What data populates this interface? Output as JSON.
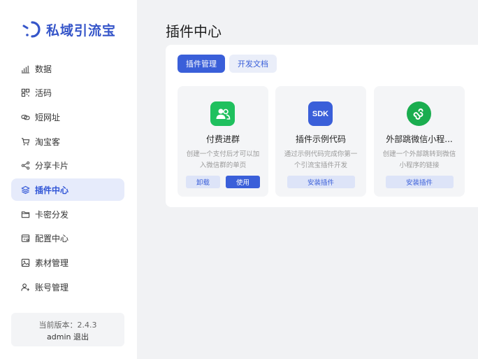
{
  "brand": {
    "name": "私域引流宝",
    "color": "#3555c9"
  },
  "sidebar": {
    "items": [
      {
        "label": "数据",
        "icon": "bar-chart-icon",
        "active": false
      },
      {
        "label": "活码",
        "icon": "qrcode-icon",
        "active": false
      },
      {
        "label": "短网址",
        "icon": "link-icon",
        "active": false
      },
      {
        "label": "淘宝客",
        "icon": "cart-icon",
        "active": false
      },
      {
        "label": "分享卡片",
        "icon": "share-icon",
        "active": false
      },
      {
        "label": "插件中心",
        "icon": "layers-icon",
        "active": true
      },
      {
        "label": "卡密分发",
        "icon": "folder-icon",
        "active": false
      },
      {
        "label": "配置中心",
        "icon": "settings-card-icon",
        "active": false
      },
      {
        "label": "素材管理",
        "icon": "image-icon",
        "active": false
      },
      {
        "label": "账号管理",
        "icon": "user-add-icon",
        "active": false
      }
    ],
    "version_label": "当前版本：2.4.3",
    "username": "admin",
    "logout_label": "退出"
  },
  "main": {
    "title": "插件中心",
    "tabs": [
      {
        "label": "插件管理",
        "active": true
      },
      {
        "label": "开发文档",
        "active": false
      }
    ],
    "plugins": [
      {
        "title": "付费进群",
        "desc": "创建一个支付后才可以加入微信群的单页",
        "icon": "group-users-icon",
        "icon_color": "#1fc05e",
        "buttons": [
          "卸载",
          "使用"
        ]
      },
      {
        "title": "插件示例代码",
        "desc": "通过示例代码完成你第一个引流宝插件开发",
        "icon": "sdk-icon",
        "icon_text": "SDK",
        "icon_color": "#3a5fd9",
        "buttons": [
          "安装插件"
        ]
      },
      {
        "title": "外部跳微信小程...",
        "desc": "创建一个外部跳转到微信小程序的链接",
        "icon": "mini-program-icon",
        "icon_color": "#1aad4f",
        "buttons": [
          "安装插件"
        ]
      }
    ]
  },
  "colors": {
    "accent": "#3a5fd9",
    "active_bg": "#e6ebfb"
  }
}
